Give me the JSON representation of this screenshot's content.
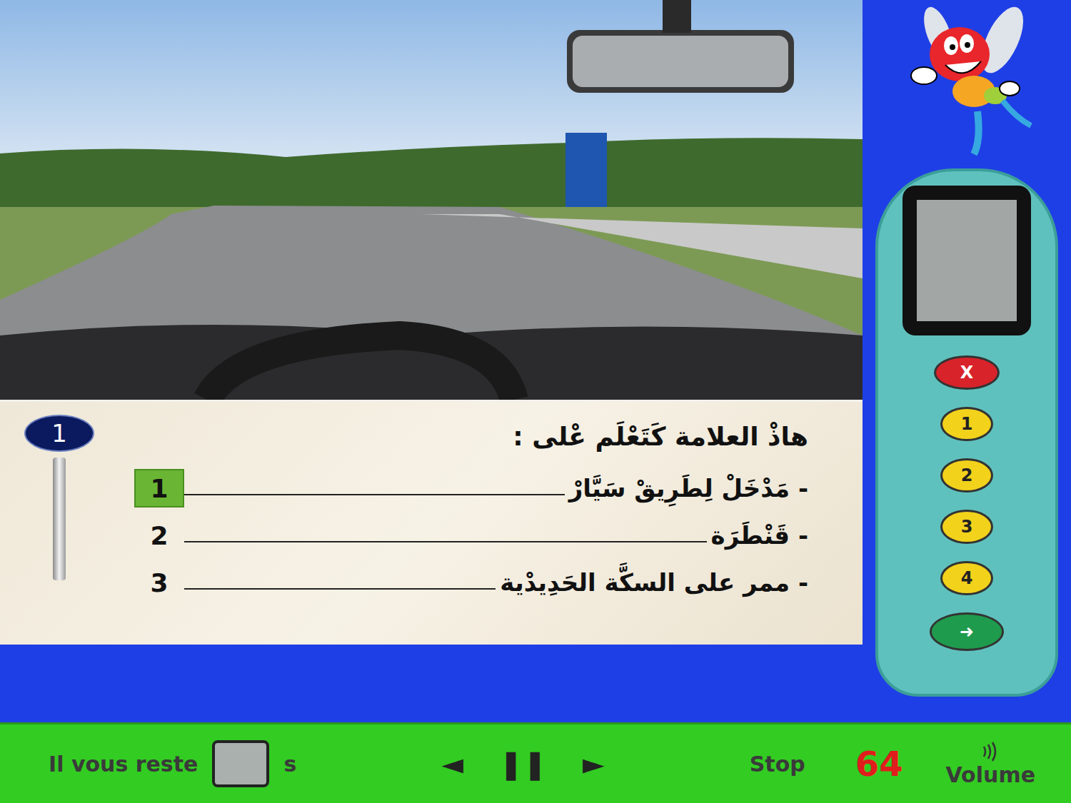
{
  "question": {
    "number": "1",
    "text": "هاذْ العلامة كَتَعْلَم عْلى :"
  },
  "options": [
    {
      "label": "1",
      "text": "- مَدْخَلْ لِطَرِيقْ سَيَّارْ",
      "selected": true
    },
    {
      "label": "2",
      "text": "- قَنْطَرَة",
      "selected": false
    },
    {
      "label": "3",
      "text": "- ممر على السكَّة الحَدِيدْية",
      "selected": false
    }
  ],
  "remote": {
    "buttons": [
      {
        "label": "X",
        "kind": "cancel"
      },
      {
        "label": "1",
        "kind": "number"
      },
      {
        "label": "2",
        "kind": "number"
      },
      {
        "label": "3",
        "kind": "number"
      },
      {
        "label": "4",
        "kind": "number"
      },
      {
        "label": "➜",
        "kind": "validate"
      }
    ]
  },
  "toolbar": {
    "remaining_label": "Il vous reste",
    "unit": "s",
    "prev": "◄",
    "pause": "❚❚",
    "next": "►",
    "stop": "Stop",
    "count": "64",
    "volume": "Volume"
  }
}
